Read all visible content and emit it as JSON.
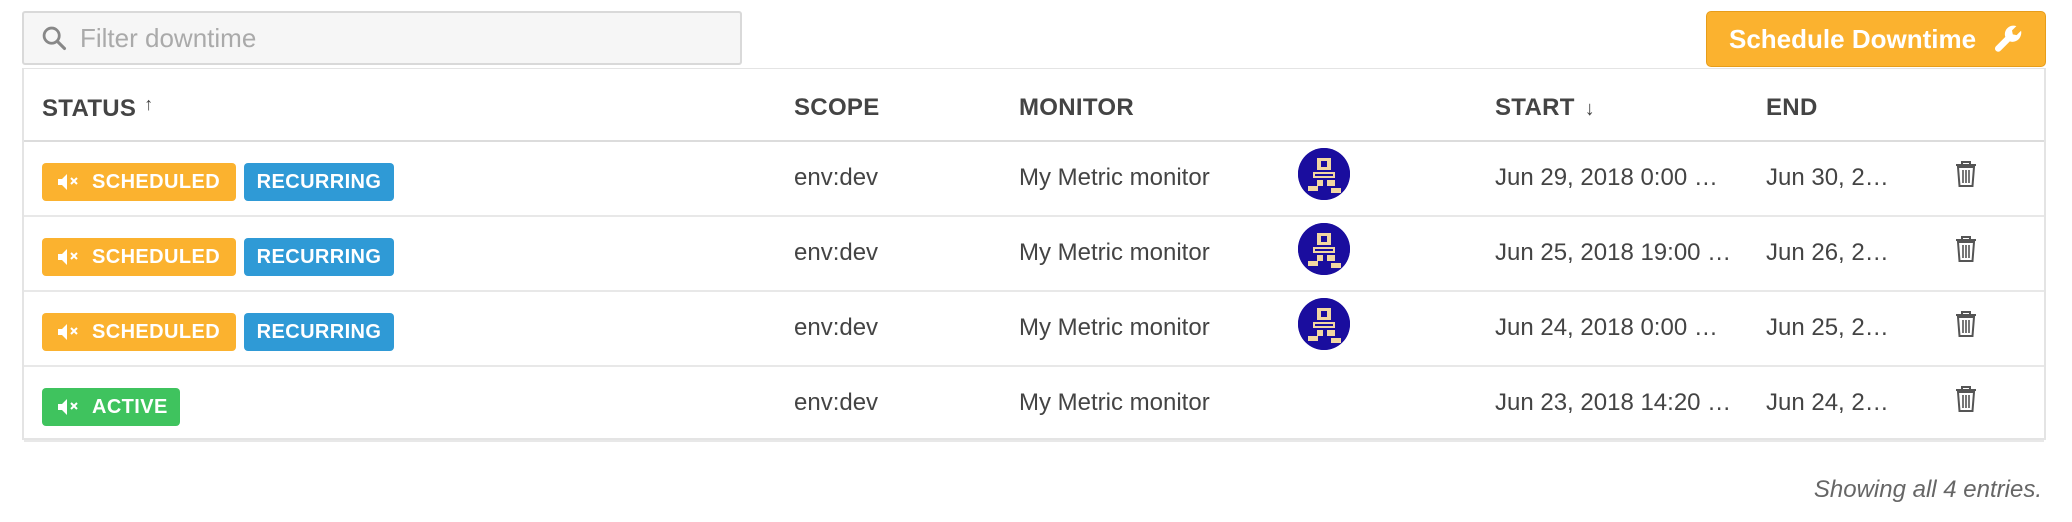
{
  "search": {
    "placeholder": "Filter downtime"
  },
  "schedule_button": {
    "label": "Schedule Downtime"
  },
  "columns": {
    "status": "STATUS",
    "status_sort": "↑",
    "scope": "SCOPE",
    "monitor": "MONITOR",
    "start": "START",
    "start_sort": "↓",
    "end": "END"
  },
  "rows": [
    {
      "status": "SCHEDULED",
      "recurring": "RECURRING",
      "scope": "env:dev",
      "monitor": "My Metric monitor",
      "start": "Jun 29, 2018 0:00 …",
      "end": "Jun 30, 2…"
    },
    {
      "status": "SCHEDULED",
      "recurring": "RECURRING",
      "scope": "env:dev",
      "monitor": "My Metric monitor",
      "start": "Jun 25, 2018 19:00 …",
      "end": "Jun 26, 2…"
    },
    {
      "status": "SCHEDULED",
      "recurring": "RECURRING",
      "scope": "env:dev",
      "monitor": "My Metric monitor",
      "start": "Jun 24, 2018 0:00 …",
      "end": "Jun 25, 2…"
    },
    {
      "status": "ACTIVE",
      "scope": "env:dev",
      "monitor": "My Metric monitor",
      "start": "Jun 23, 2018 14:20 …",
      "end": "Jun 24, 2…"
    }
  ],
  "footer": {
    "text": "Showing all 4 entries."
  },
  "colors": {
    "scheduled": "#fbb22f",
    "recurring": "#2f9ad6",
    "active": "#3fc35e",
    "primary_button": "#fbb22f"
  },
  "icons": {
    "search": "search-icon",
    "wrench": "wrench-icon",
    "mute": "mute-icon",
    "delete": "trash-icon",
    "avatar": "user-avatar"
  }
}
